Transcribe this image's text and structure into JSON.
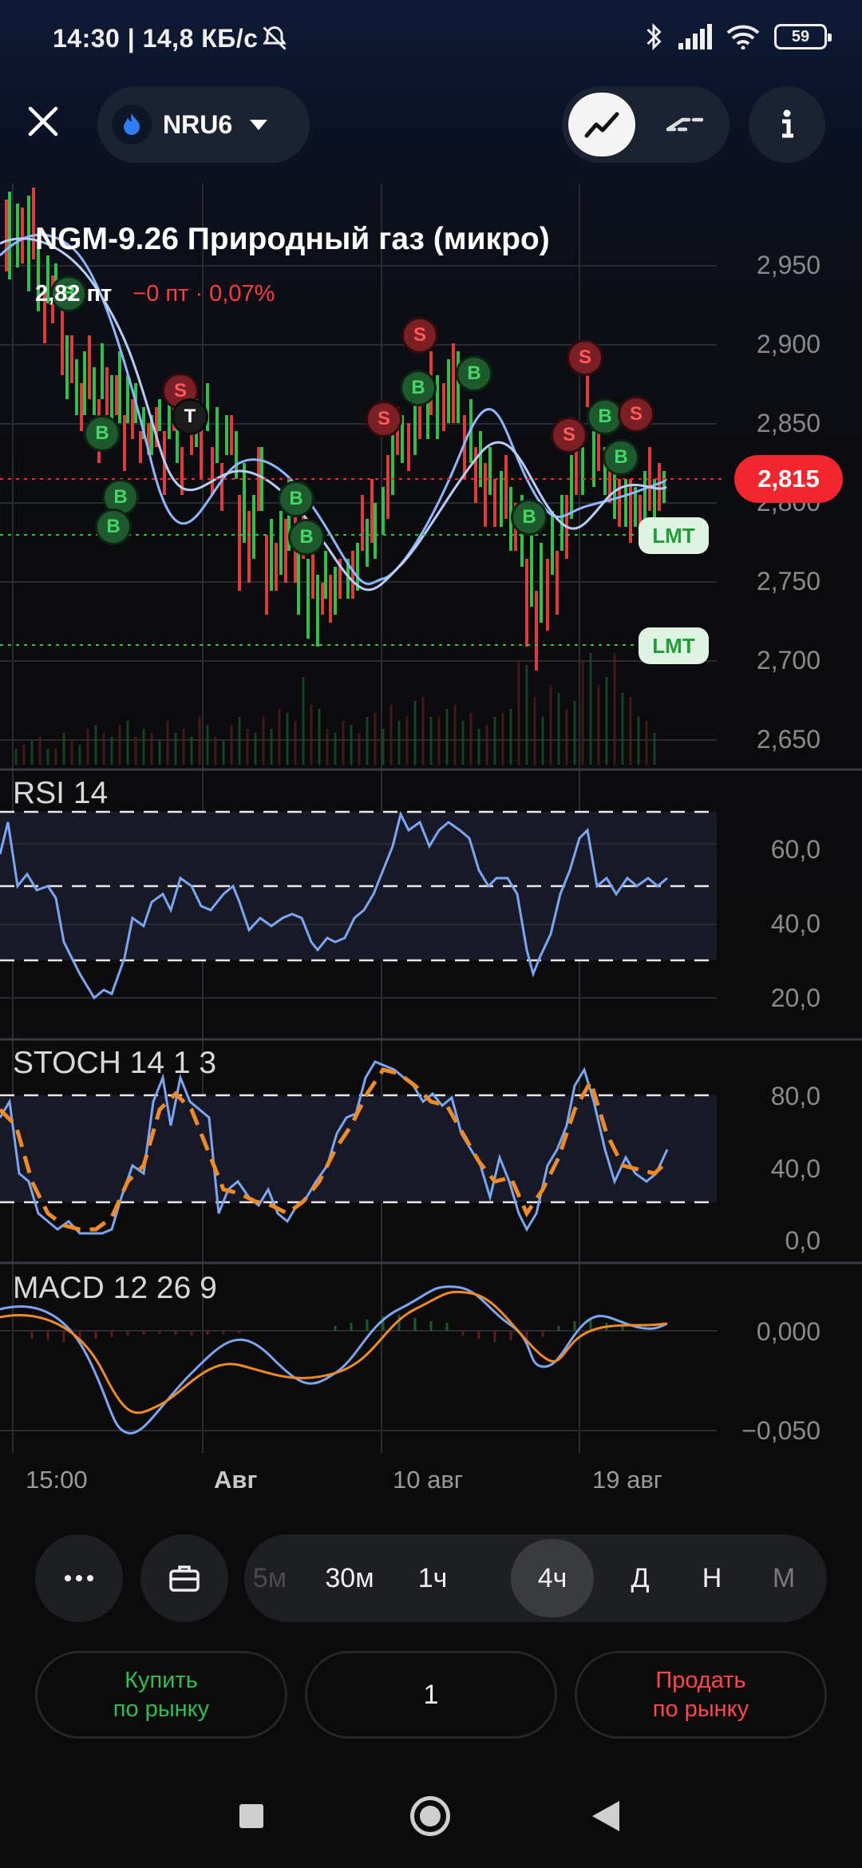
{
  "status_bar": {
    "time": "14:30 | 14,8 КБ/с",
    "battery": "59",
    "icons": [
      "mute-bell-icon",
      "bluetooth-icon",
      "signal-icon",
      "wifi-icon",
      "battery-icon"
    ]
  },
  "header": {
    "ticker": "NRU6",
    "close_icon": "close-icon",
    "chart_mode_icons": [
      "line-chart-icon",
      "dashed-lines-icon"
    ],
    "info_icon": "info-icon"
  },
  "instrument": {
    "title": "NGM-9.26 Природный газ (микро)",
    "points": "2,82 пт",
    "change": "−0 пт · 0,07%"
  },
  "price_axis": {
    "labels": [
      "2,950",
      "2,900",
      "2,850",
      "2,800",
      "2,750",
      "2,700",
      "2,650"
    ],
    "current_price": "2,815"
  },
  "orders": {
    "lmt_label_1": "LMT",
    "lmt_label_2": "LMT"
  },
  "indicators": {
    "rsi": {
      "label": "RSI 14",
      "axis": [
        "60,0",
        "40,0",
        "20,0"
      ]
    },
    "stoch": {
      "label": "STOCH 14 1 3",
      "axis": [
        "80,0",
        "40,0",
        "0,0"
      ]
    },
    "macd": {
      "label": "MACD 12 26 9",
      "axis": [
        "0,000",
        "−0,050"
      ]
    }
  },
  "x_axis": [
    "15:00",
    "Авг",
    "10 авг",
    "19 авг"
  ],
  "trade_markers": [
    {
      "type": "B"
    },
    {
      "type": "B"
    },
    {
      "type": "B"
    },
    {
      "type": "B"
    },
    {
      "type": "B"
    },
    {
      "type": "S"
    },
    {
      "type": "T"
    },
    {
      "type": "B"
    },
    {
      "type": "B"
    },
    {
      "type": "S"
    },
    {
      "type": "B"
    },
    {
      "type": "S"
    },
    {
      "type": "B"
    },
    {
      "type": "B"
    },
    {
      "type": "S"
    },
    {
      "type": "S"
    },
    {
      "type": "B"
    },
    {
      "type": "S"
    },
    {
      "type": "B"
    }
  ],
  "toolbar": {
    "more_icon": "more-icon",
    "portfolio_icon": "briefcase-icon",
    "timeframes": [
      "5м",
      "30м",
      "1ч",
      "4ч",
      "Д",
      "Н",
      "М"
    ],
    "active_timeframe": "4ч"
  },
  "trade": {
    "buy_line1": "Купить",
    "buy_line2": "по рынку",
    "quantity": "1",
    "sell_line1": "Продать",
    "sell_line2": "по рынку"
  },
  "nav": [
    "recents-icon",
    "home-icon",
    "back-icon"
  ]
}
